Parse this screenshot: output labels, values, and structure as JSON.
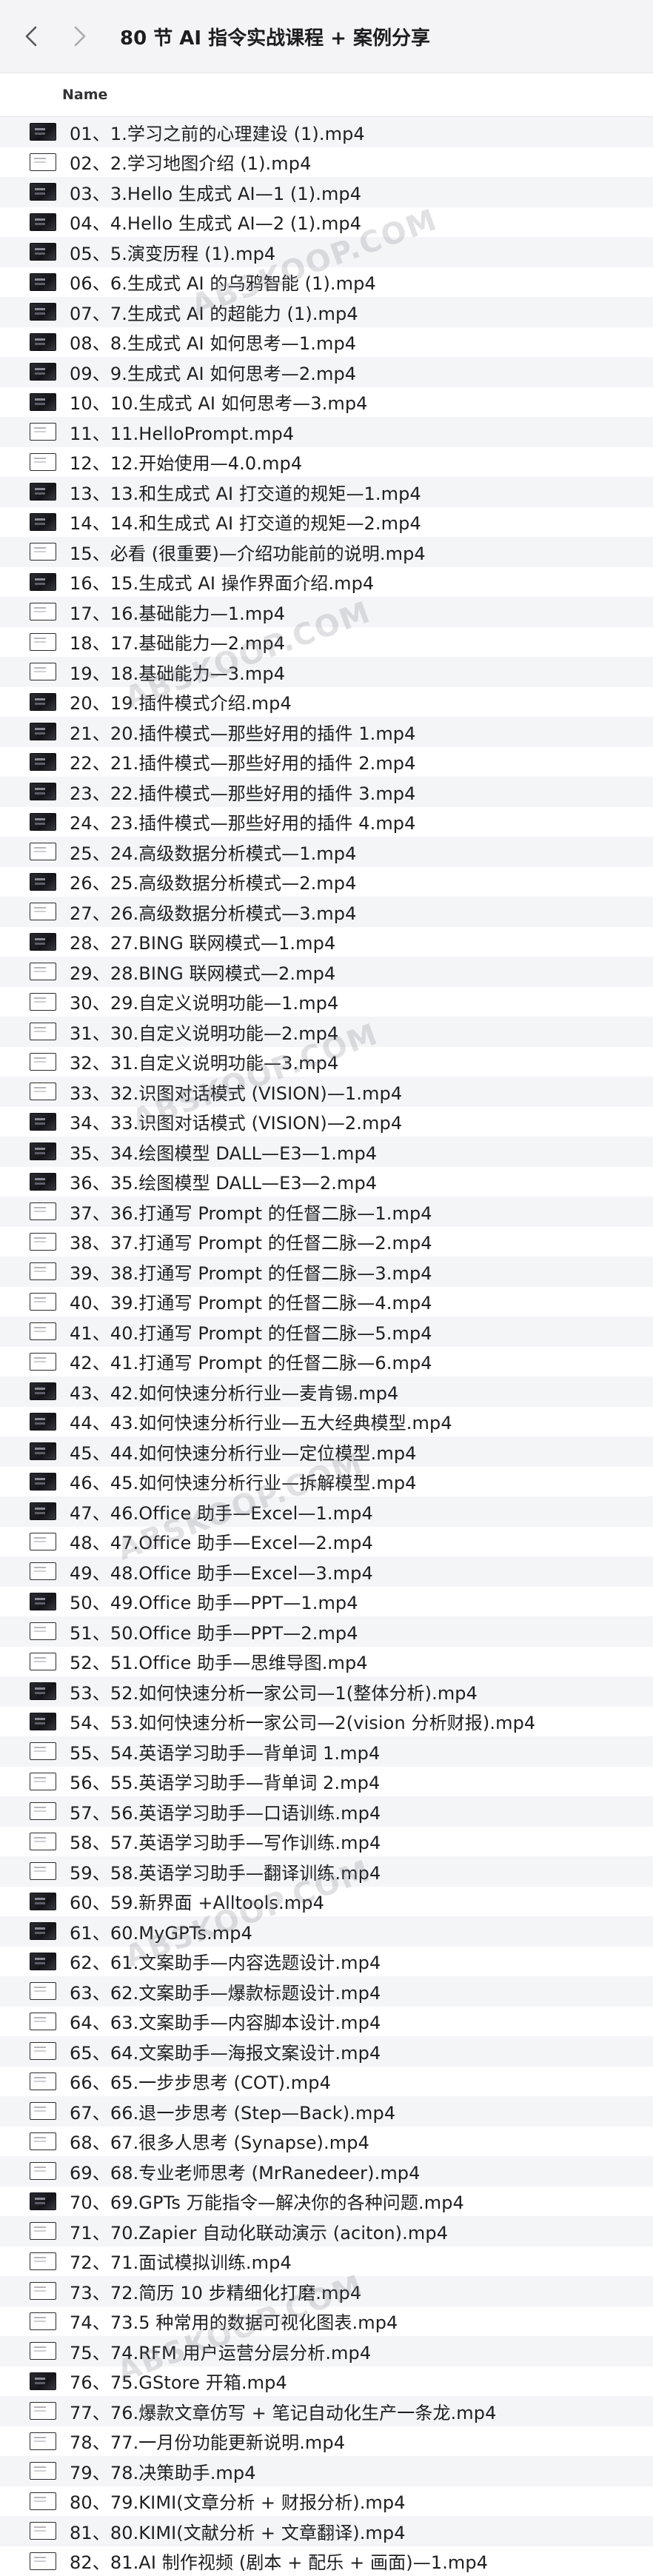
{
  "window": {
    "title": "80 节 AI 指令实战课程 + 案例分享",
    "icons": {
      "back": "chevron-left-icon",
      "forward": "chevron-right-icon"
    }
  },
  "list": {
    "column_header": "Name",
    "watermark_text": "ABSKOOP.COM",
    "files": [
      {
        "name": "01、1.学习之前的心理建设 (1).mp4",
        "thumb": "dark"
      },
      {
        "name": "02、2.学习地图介绍 (1).mp4",
        "thumb": "light"
      },
      {
        "name": "03、3.Hello 生成式 AI—1 (1).mp4",
        "thumb": "dark"
      },
      {
        "name": "04、4.Hello 生成式 AI—2 (1).mp4",
        "thumb": "dark"
      },
      {
        "name": "05、5.演变历程 (1).mp4",
        "thumb": "dark"
      },
      {
        "name": "06、6.生成式 AI 的乌鸦智能 (1).mp4",
        "thumb": "dark"
      },
      {
        "name": "07、7.生成式 AI 的超能力 (1).mp4",
        "thumb": "dark"
      },
      {
        "name": "08、8.生成式 AI 如何思考—1.mp4",
        "thumb": "dark"
      },
      {
        "name": "09、9.生成式 AI 如何思考—2.mp4",
        "thumb": "dark"
      },
      {
        "name": "10、10.生成式 AI 如何思考—3.mp4",
        "thumb": "dark"
      },
      {
        "name": "11、11.HelloPrompt.mp4",
        "thumb": "light"
      },
      {
        "name": "12、12.开始使用—4.0.mp4",
        "thumb": "light"
      },
      {
        "name": "13、13.和生成式 AI 打交道的规矩—1.mp4",
        "thumb": "dark"
      },
      {
        "name": "14、14.和生成式 AI 打交道的规矩—2.mp4",
        "thumb": "dark"
      },
      {
        "name": "15、必看 (很重要)—介绍功能前的说明.mp4",
        "thumb": "light"
      },
      {
        "name": "16、15.生成式 AI 操作界面介绍.mp4",
        "thumb": "dark"
      },
      {
        "name": "17、16.基础能力—1.mp4",
        "thumb": "light"
      },
      {
        "name": "18、17.基础能力—2.mp4",
        "thumb": "light"
      },
      {
        "name": "19、18.基础能力—3.mp4",
        "thumb": "light"
      },
      {
        "name": "20、19.插件模式介绍.mp4",
        "thumb": "dark"
      },
      {
        "name": "21、20.插件模式—那些好用的插件 1.mp4",
        "thumb": "dark"
      },
      {
        "name": "22、21.插件模式—那些好用的插件 2.mp4",
        "thumb": "dark"
      },
      {
        "name": "23、22.插件模式—那些好用的插件 3.mp4",
        "thumb": "dark"
      },
      {
        "name": "24、23.插件模式—那些好用的插件 4.mp4",
        "thumb": "dark"
      },
      {
        "name": "25、24.高级数据分析模式—1.mp4",
        "thumb": "light"
      },
      {
        "name": "26、25.高级数据分析模式—2.mp4",
        "thumb": "dark"
      },
      {
        "name": "27、26.高级数据分析模式—3.mp4",
        "thumb": "light"
      },
      {
        "name": "28、27.BING 联网模式—1.mp4",
        "thumb": "dark"
      },
      {
        "name": "29、28.BING 联网模式—2.mp4",
        "thumb": "light"
      },
      {
        "name": "30、29.自定义说明功能—1.mp4",
        "thumb": "light"
      },
      {
        "name": "31、30.自定义说明功能—2.mp4",
        "thumb": "light"
      },
      {
        "name": "32、31.自定义说明功能—3.mp4",
        "thumb": "light"
      },
      {
        "name": "33、32.识图对话模式 (VISION)—1.mp4",
        "thumb": "light"
      },
      {
        "name": "34、33.识图对话模式 (VISION)—2.mp4",
        "thumb": "dark"
      },
      {
        "name": "35、34.绘图模型 DALL—E3—1.mp4",
        "thumb": "dark"
      },
      {
        "name": "36、35.绘图模型 DALL—E3—2.mp4",
        "thumb": "dark"
      },
      {
        "name": "37、36.打通写 Prompt 的任督二脉—1.mp4",
        "thumb": "light"
      },
      {
        "name": "38、37.打通写 Prompt 的任督二脉—2.mp4",
        "thumb": "light"
      },
      {
        "name": "39、38.打通写 Prompt 的任督二脉—3.mp4",
        "thumb": "light"
      },
      {
        "name": "40、39.打通写 Prompt 的任督二脉—4.mp4",
        "thumb": "light"
      },
      {
        "name": "41、40.打通写 Prompt 的任督二脉—5.mp4",
        "thumb": "light"
      },
      {
        "name": "42、41.打通写 Prompt 的任督二脉—6.mp4",
        "thumb": "light"
      },
      {
        "name": "43、42.如何快速分析行业—麦肯锡.mp4",
        "thumb": "dark"
      },
      {
        "name": "44、43.如何快速分析行业—五大经典模型.mp4",
        "thumb": "dark"
      },
      {
        "name": "45、44.如何快速分析行业—定位模型.mp4",
        "thumb": "dark"
      },
      {
        "name": "46、45.如何快速分析行业—拆解模型.mp4",
        "thumb": "dark"
      },
      {
        "name": "47、46.Office 助手—Excel—1.mp4",
        "thumb": "dark"
      },
      {
        "name": "48、47.Office 助手—Excel—2.mp4",
        "thumb": "light"
      },
      {
        "name": "49、48.Office 助手—Excel—3.mp4",
        "thumb": "light"
      },
      {
        "name": "50、49.Office 助手—PPT—1.mp4",
        "thumb": "dark"
      },
      {
        "name": "51、50.Office 助手—PPT—2.mp4",
        "thumb": "light"
      },
      {
        "name": "52、51.Office 助手—思维导图.mp4",
        "thumb": "light"
      },
      {
        "name": "53、52.如何快速分析一家公司—1(整体分析).mp4",
        "thumb": "dark"
      },
      {
        "name": "54、53.如何快速分析一家公司—2(vision 分析财报).mp4",
        "thumb": "dark"
      },
      {
        "name": "55、54.英语学习助手—背单词 1.mp4",
        "thumb": "light"
      },
      {
        "name": "56、55.英语学习助手—背单词 2.mp4",
        "thumb": "light"
      },
      {
        "name": "57、56.英语学习助手—口语训练.mp4",
        "thumb": "light"
      },
      {
        "name": "58、57.英语学习助手—写作训练.mp4",
        "thumb": "light"
      },
      {
        "name": "59、58.英语学习助手—翻译训练.mp4",
        "thumb": "light"
      },
      {
        "name": "60、59.新界面 +Alltools.mp4",
        "thumb": "dark"
      },
      {
        "name": "61、60.MyGPTs.mp4",
        "thumb": "dark"
      },
      {
        "name": "62、61.文案助手—内容选题设计.mp4",
        "thumb": "dark"
      },
      {
        "name": "63、62.文案助手—爆款标题设计.mp4",
        "thumb": "light"
      },
      {
        "name": "64、63.文案助手—内容脚本设计.mp4",
        "thumb": "light"
      },
      {
        "name": "65、64.文案助手—海报文案设计.mp4",
        "thumb": "light"
      },
      {
        "name": "66、65.一步步思考 (COT).mp4",
        "thumb": "light"
      },
      {
        "name": "67、66.退一步思考 (Step—Back).mp4",
        "thumb": "light"
      },
      {
        "name": "68、67.很多人思考 (Synapse).mp4",
        "thumb": "light"
      },
      {
        "name": "69、68.专业老师思考 (MrRanedeer).mp4",
        "thumb": "light"
      },
      {
        "name": "70、69.GPTs 万能指令—解决你的各种问题.mp4",
        "thumb": "dark"
      },
      {
        "name": "71、70.Zapier 自动化联动演示 (aciton).mp4",
        "thumb": "light"
      },
      {
        "name": "72、71.面试模拟训练.mp4",
        "thumb": "light"
      },
      {
        "name": "73、72.简历 10 步精细化打磨.mp4",
        "thumb": "light"
      },
      {
        "name": "74、73.5 种常用的数据可视化图表.mp4",
        "thumb": "light"
      },
      {
        "name": "75、74.RFM 用户运营分层分析.mp4",
        "thumb": "light"
      },
      {
        "name": "76、75.GStore 开箱.mp4",
        "thumb": "dark"
      },
      {
        "name": "77、76.爆款文章仿写 + 笔记自动化生产一条龙.mp4",
        "thumb": "light"
      },
      {
        "name": "78、77.一月份功能更新说明.mp4",
        "thumb": "light"
      },
      {
        "name": "79、78.决策助手.mp4",
        "thumb": "light"
      },
      {
        "name": "80、79.KIMI(文章分析 + 财报分析).mp4",
        "thumb": "light"
      },
      {
        "name": "81、80.KIMI(文献分析 + 文章翻译).mp4",
        "thumb": "light"
      },
      {
        "name": "82、81.AI 制作视频 (剧本 + 配乐 + 画面)—1.mp4",
        "thumb": "light"
      }
    ]
  }
}
